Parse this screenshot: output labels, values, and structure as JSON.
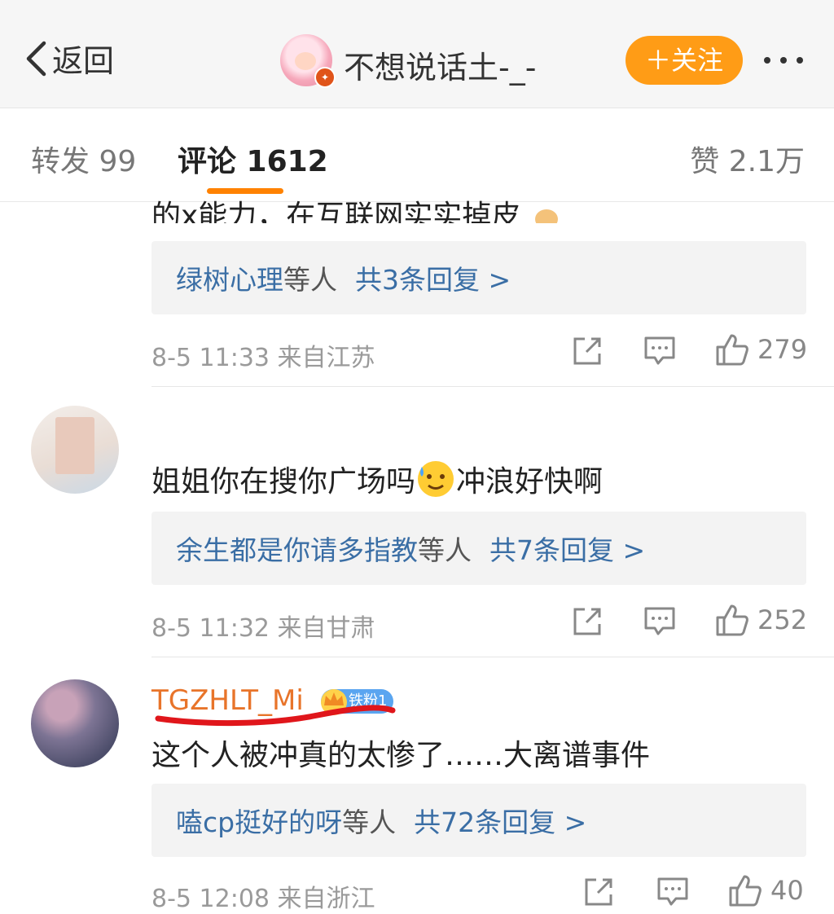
{
  "header": {
    "back_label": "返回",
    "profile_name": "不想说话土-_-",
    "follow_label": "＋关注"
  },
  "tabs": {
    "forward": "转发 99",
    "comment": "评论 1612",
    "like": "赞 2.1万"
  },
  "colors": {
    "accent_orange": "#ff9c16",
    "link_blue": "#3a6ea5",
    "username_orange": "#e8742a"
  },
  "comments": [
    {
      "text_partial": "的x能力，在互联网实实掉皮",
      "reply_names": "绿树心理",
      "reply_etc": "等人",
      "reply_count": "共3条回复 >",
      "meta": "8-5 11:33 来自江苏",
      "likes": "279"
    },
    {
      "text_a": "姐姐你在搜你广场吗",
      "text_b": "冲浪好快啊",
      "reply_names": "余生都是你请多指教",
      "reply_etc": "等人",
      "reply_count": "共7条回复 >",
      "meta": "8-5 11:32 来自甘肃",
      "likes": "252"
    },
    {
      "username": "TGZHLT_Mi",
      "badge": "铁粉1",
      "text": "这个人被冲真的太惨了……大离谱事件",
      "reply_names": "嗑cp挺好的呀",
      "reply_etc": "等人",
      "reply_count": "共72条回复 >",
      "meta": "8-5 12:08 来自浙江",
      "likes": "40"
    }
  ],
  "icons": [
    "back-chevron-icon",
    "verified-badge-icon",
    "more-dots-icon",
    "share-icon",
    "comment-icon",
    "thumbs-up-icon",
    "crown-icon",
    "emoji-sweat-icon"
  ]
}
